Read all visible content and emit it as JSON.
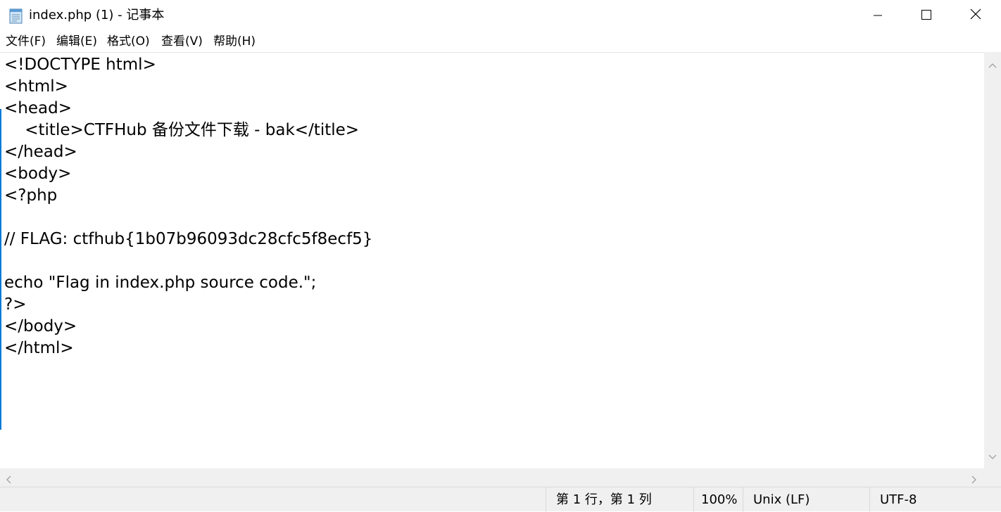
{
  "window": {
    "title": "index.php (1) - 记事本",
    "icon": "notepad-icon",
    "controls": {
      "minimize": "minimize-icon",
      "maximize": "maximize-icon",
      "close": "close-icon"
    }
  },
  "menu": [
    {
      "label": "文件(F)"
    },
    {
      "label": "编辑(E)"
    },
    {
      "label": "格式(O)"
    },
    {
      "label": "查看(V)"
    },
    {
      "label": "帮助(H)"
    }
  ],
  "editor": {
    "lines": [
      "<!DOCTYPE html>",
      "<html>",
      "<head>",
      "    <title>CTFHub 备份文件下载 - bak</title>",
      "</head>",
      "<body>",
      "<?php",
      "",
      "// FLAG: ctfhub{1b07b96093dc28cfc5f8ecf5}",
      "",
      "echo \"Flag in index.php source code.\";",
      "?>",
      "</body>",
      "</html>"
    ]
  },
  "status": {
    "position": "第 1 行，第 1 列",
    "zoom": "100%",
    "line_ending": "Unix (LF)",
    "encoding": "UTF-8"
  },
  "colors": {
    "chrome_bg": "#f0f0f0",
    "caret": "#0078d7",
    "text": "#000000"
  }
}
